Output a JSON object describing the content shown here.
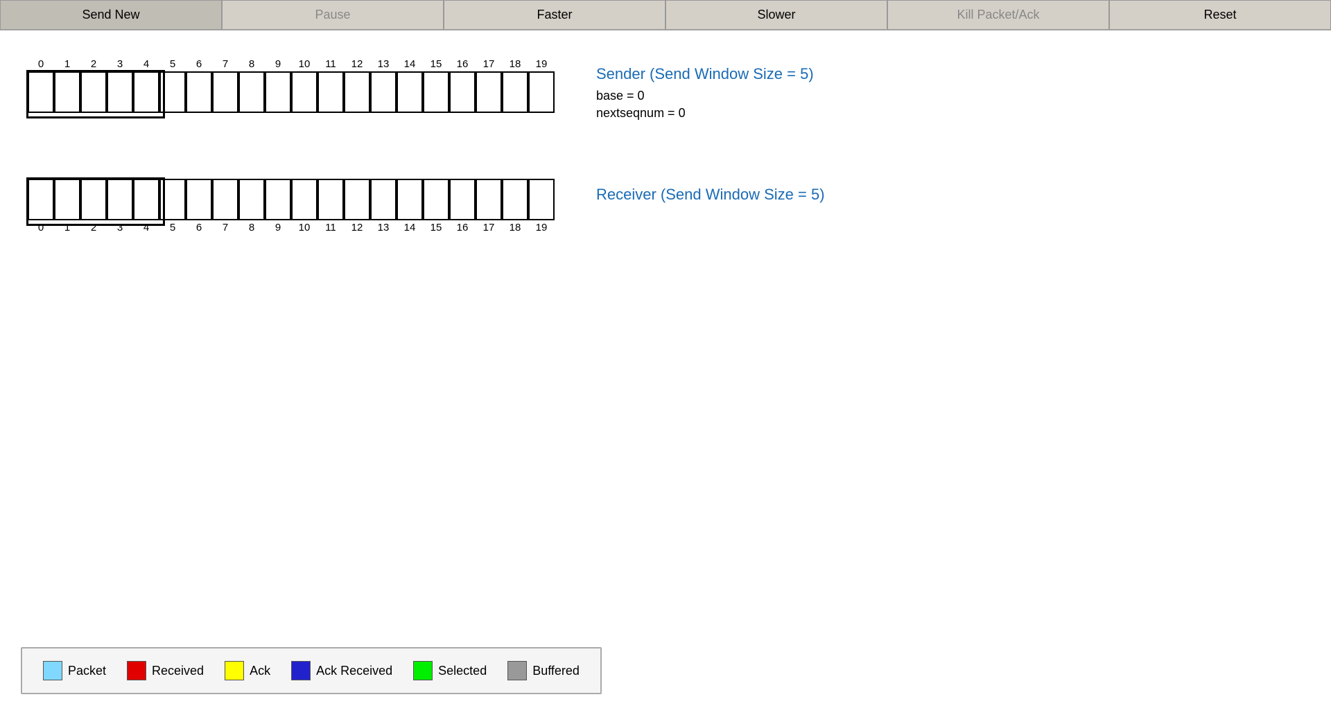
{
  "toolbar": {
    "buttons": [
      {
        "label": "Send New",
        "id": "send-new",
        "disabled": false
      },
      {
        "label": "Pause",
        "id": "pause",
        "disabled": false
      },
      {
        "label": "Faster",
        "id": "faster",
        "disabled": false
      },
      {
        "label": "Slower",
        "id": "slower",
        "disabled": false
      },
      {
        "label": "Kill Packet/Ack",
        "id": "kill-packet-ack",
        "disabled": true
      },
      {
        "label": "Reset",
        "id": "reset",
        "disabled": false
      }
    ]
  },
  "sender": {
    "title": "Sender (Send Window Size = 5)",
    "base_label": "base = 0",
    "nextseqnum_label": "nextseqnum = 0"
  },
  "receiver": {
    "title": "Receiver (Send Window Size = 5)"
  },
  "packet_count": 20,
  "window_size": 5,
  "numbers": [
    "0",
    "1",
    "2",
    "3",
    "4",
    "5",
    "6",
    "7",
    "8",
    "9",
    "10",
    "11",
    "12",
    "13",
    "14",
    "15",
    "16",
    "17",
    "18",
    "19"
  ],
  "legend": {
    "items": [
      {
        "label": "Packet",
        "color": "#80d8ff"
      },
      {
        "label": "Received",
        "color": "#e00000"
      },
      {
        "label": "Ack",
        "color": "#ffff00"
      },
      {
        "label": "Ack Received",
        "color": "#2222cc"
      },
      {
        "label": "Selected",
        "color": "#00ee00"
      },
      {
        "label": "Buffered",
        "color": "#999999"
      }
    ]
  }
}
